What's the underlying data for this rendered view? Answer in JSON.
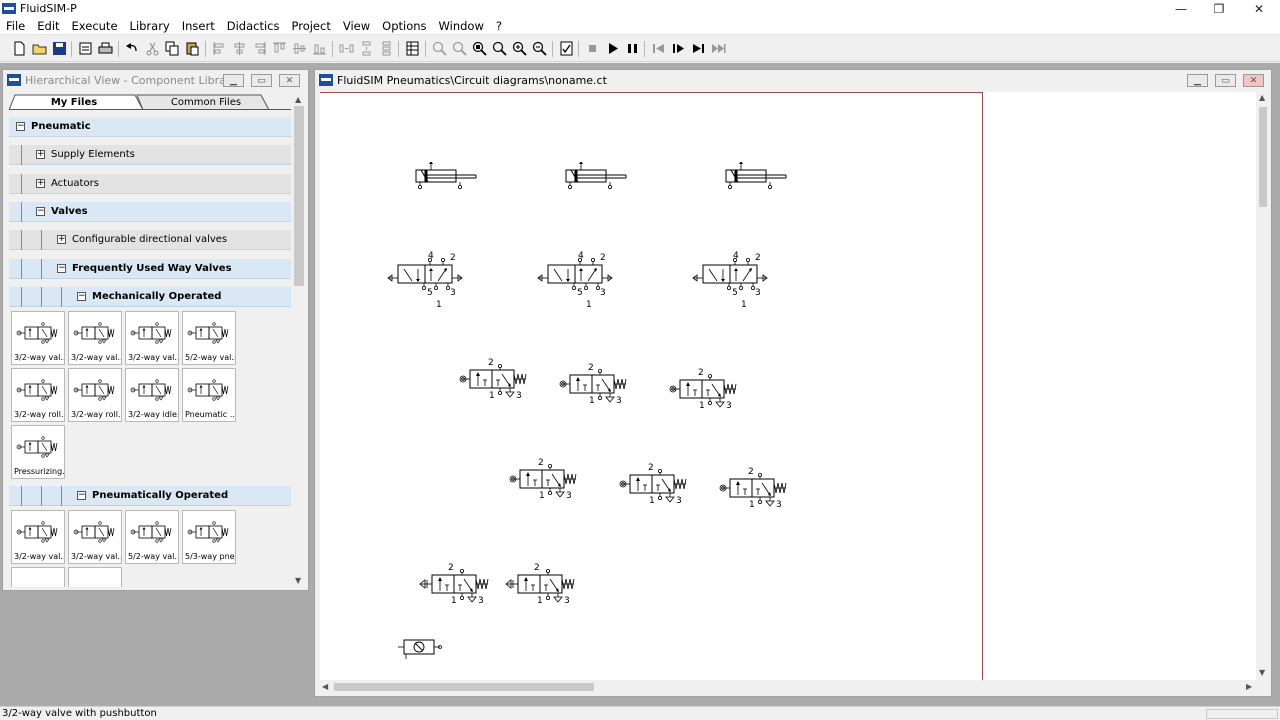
{
  "window": {
    "title": "FluidSIM-P",
    "controls": [
      "—",
      "❐",
      "✕"
    ]
  },
  "menu": [
    "File",
    "Edit",
    "Execute",
    "Library",
    "Insert",
    "Didactics",
    "Project",
    "View",
    "Options",
    "Window",
    "?"
  ],
  "left_panel": {
    "title": "Hierarchical View - Component Library",
    "tabs": [
      "My Files",
      "Common Files"
    ],
    "tree": {
      "pneumatic": "Pneumatic",
      "supply": "Supply Elements",
      "actuators": "Actuators",
      "valves": "Valves",
      "configurable": "Configurable directional valves",
      "frequently": "Frequently Used Way Valves",
      "mechanically": "Mechanically Operated",
      "pneumatically": "Pneumatically Operated"
    },
    "mech_tiles": [
      "3/2-way val...",
      "3/2-way val...",
      "3/2-way val...",
      "5/2-way val...",
      "3/2-way roll...",
      "3/2-way roll...",
      "3/2-way idle...",
      "Pneumatic ...",
      "Pressurizing..."
    ],
    "pneu_tiles": [
      "3/2-way val...",
      "3/2-way val...",
      "5/2-way val...",
      "5/3-way pne..."
    ]
  },
  "right_panel": {
    "title": "FluidSIM Pneumatics\\Circuit diagrams\\noname.ct"
  },
  "canvas": {
    "port_labels": {
      "four": "4",
      "two": "2",
      "five": "5",
      "three": "3",
      "one": "1"
    }
  },
  "status": {
    "text": "3/2-way valve with pushbutton"
  },
  "colors": {
    "tree_blue": "#d9e8f4",
    "tree_gray": "#e3e3e3",
    "page_edge": "#9c4c4c",
    "mdi_background": "#ababab"
  }
}
